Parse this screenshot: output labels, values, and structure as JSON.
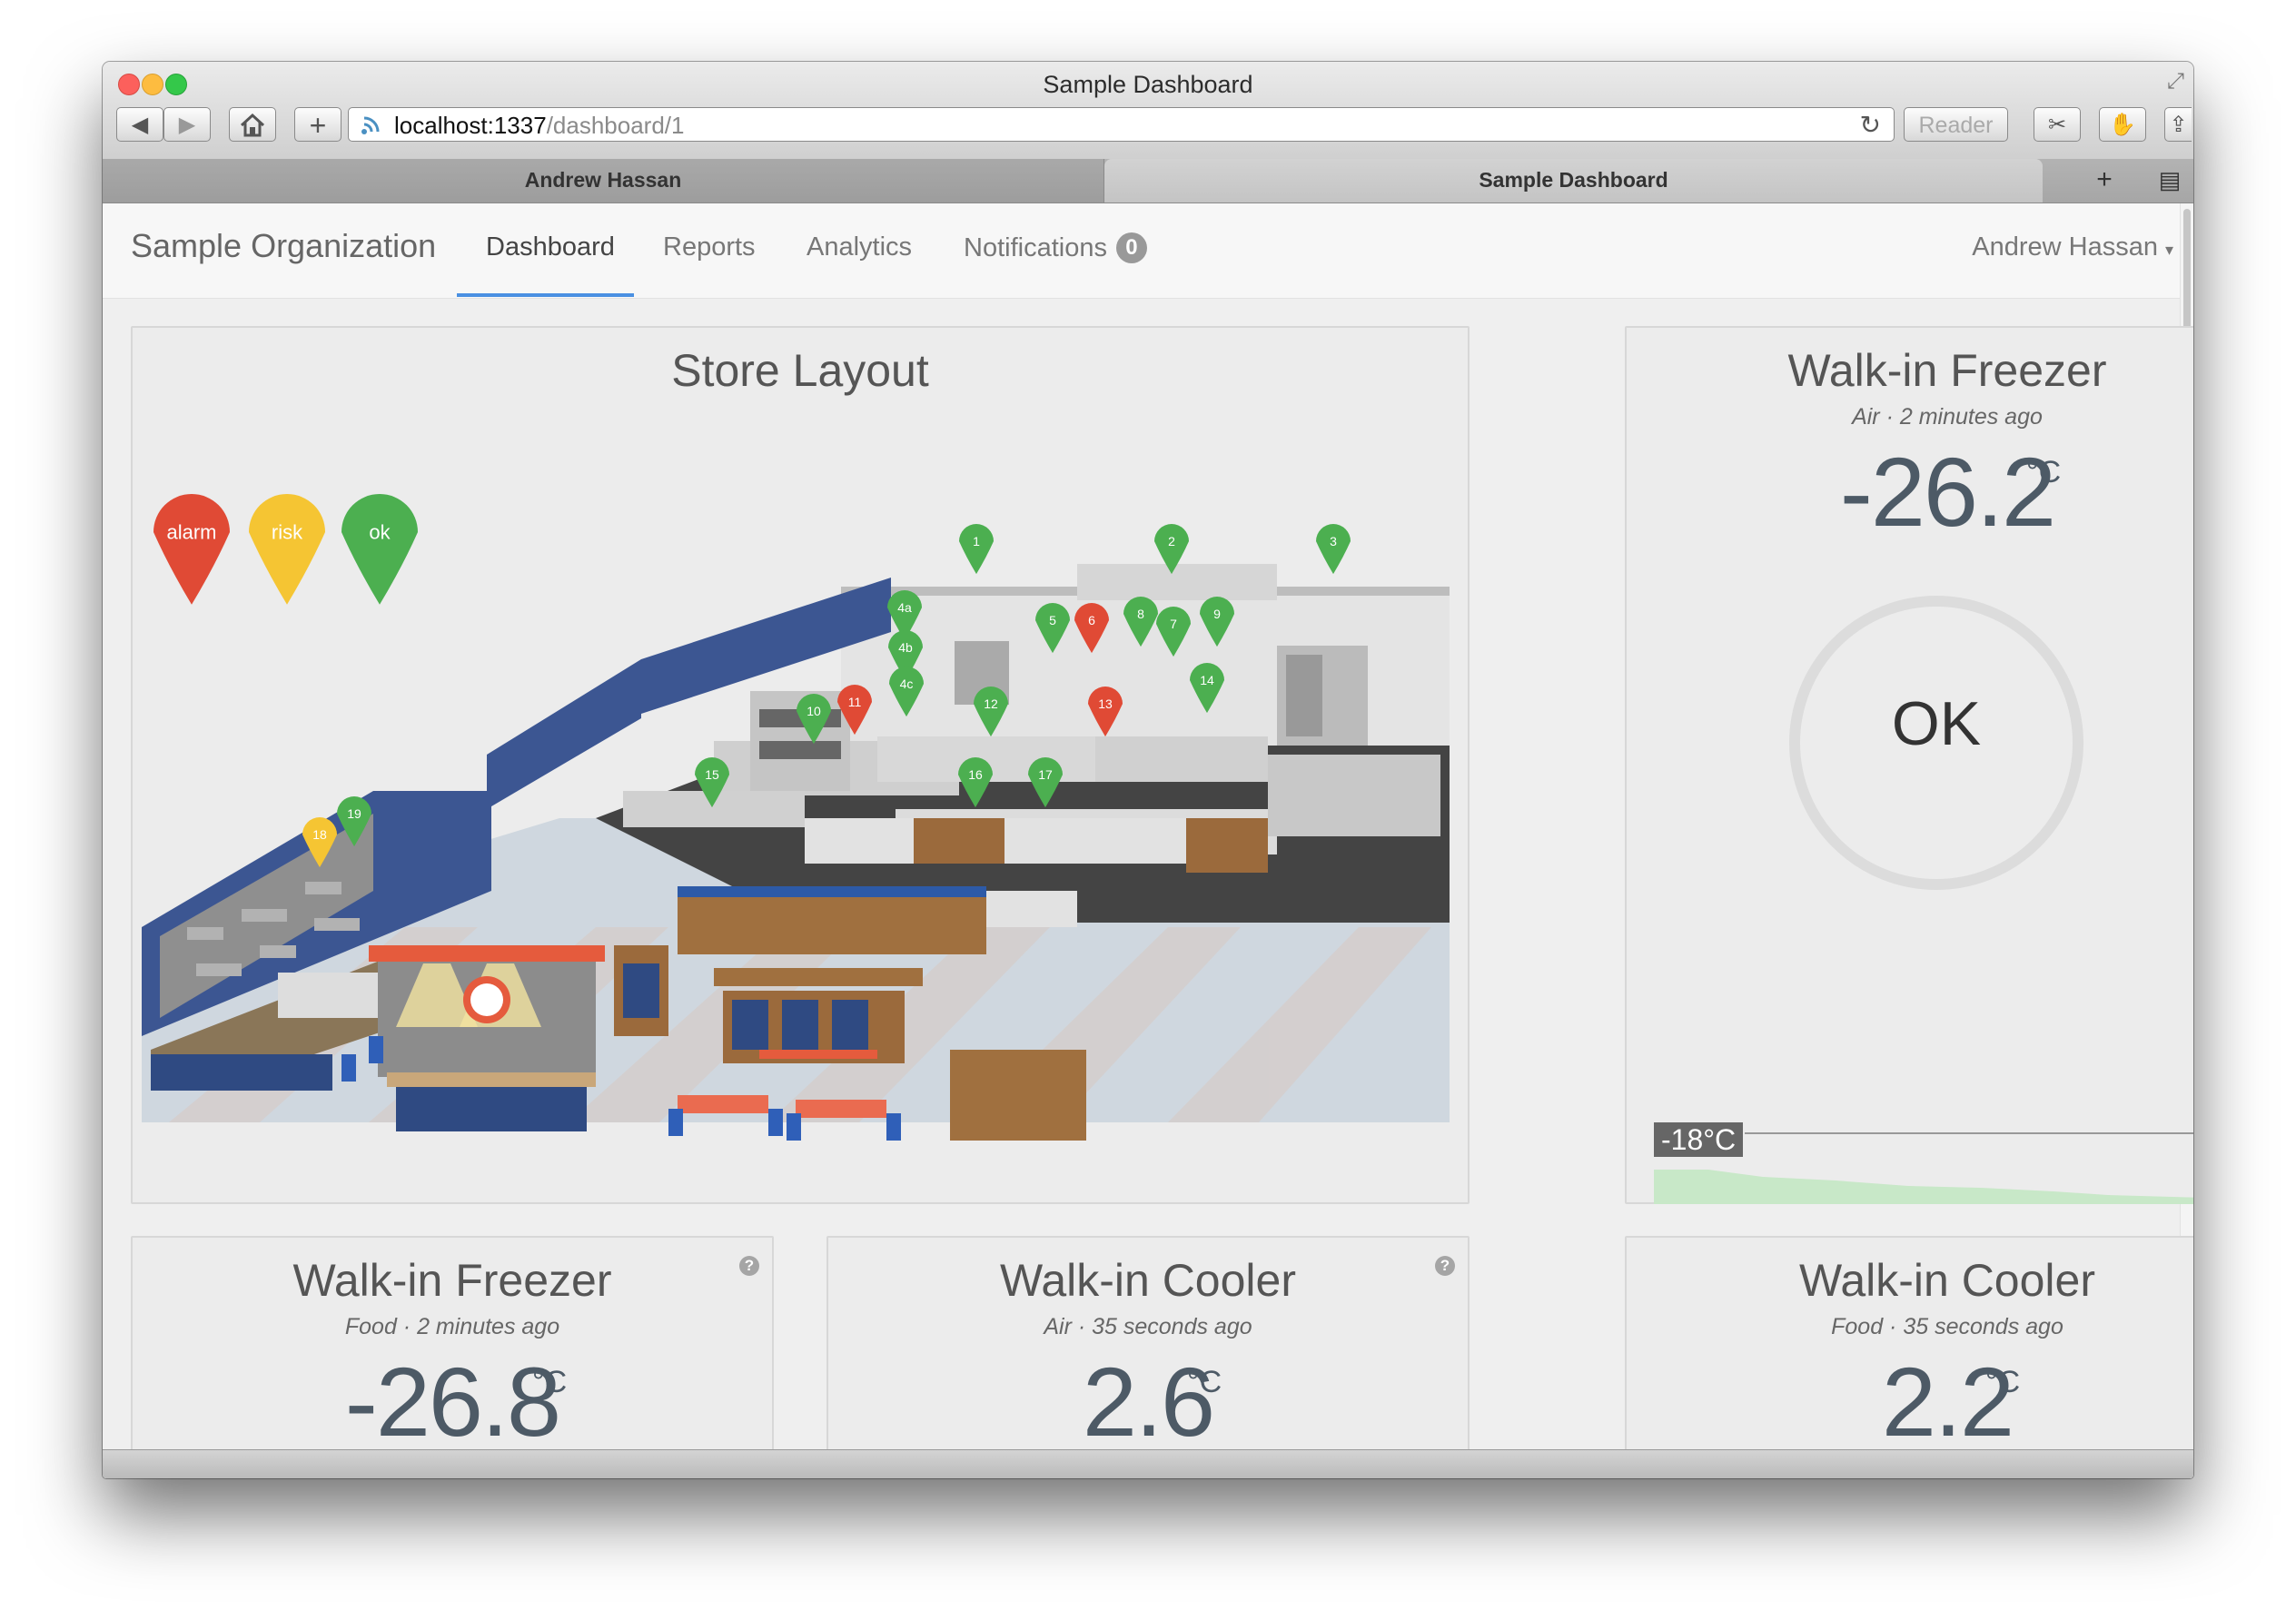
{
  "window": {
    "title": "Sample Dashboard",
    "colors": {
      "close": "#fc605c",
      "minimize": "#fdbc40",
      "zoom": "#34c84a"
    }
  },
  "toolbar": {
    "url_host": "localhost:1337",
    "url_path": "/dashboard/1",
    "reader_label": "Reader"
  },
  "tabs": [
    {
      "label": "Andrew Hassan",
      "active": false
    },
    {
      "label": "Sample Dashboard",
      "active": true
    }
  ],
  "navbar": {
    "brand": "Sample Organization",
    "items": [
      {
        "label": "Dashboard",
        "active": true
      },
      {
        "label": "Reports",
        "active": false
      },
      {
        "label": "Analytics",
        "active": false
      },
      {
        "label": "Notifications",
        "active": false,
        "badge": "0"
      }
    ],
    "user": "Andrew Hassan",
    "accent": "#4a90e2"
  },
  "store_layout": {
    "title": "Store Layout",
    "legend": [
      {
        "label": "alarm",
        "color": "#e04a35"
      },
      {
        "label": "risk",
        "color": "#f5c533"
      },
      {
        "label": "ok",
        "color": "#4caf50"
      }
    ],
    "markers": [
      {
        "label": "1",
        "status": "ok"
      },
      {
        "label": "2",
        "status": "ok"
      },
      {
        "label": "3",
        "status": "ok"
      },
      {
        "label": "4a",
        "status": "ok"
      },
      {
        "label": "4b",
        "status": "ok"
      },
      {
        "label": "4c",
        "status": "ok"
      },
      {
        "label": "5",
        "status": "ok"
      },
      {
        "label": "6",
        "status": "alarm"
      },
      {
        "label": "7",
        "status": "ok"
      },
      {
        "label": "8",
        "status": "ok"
      },
      {
        "label": "9",
        "status": "ok"
      },
      {
        "label": "10",
        "status": "ok"
      },
      {
        "label": "11",
        "status": "alarm"
      },
      {
        "label": "12",
        "status": "ok"
      },
      {
        "label": "13",
        "status": "alarm"
      },
      {
        "label": "14",
        "status": "ok"
      },
      {
        "label": "15",
        "status": "ok"
      },
      {
        "label": "16",
        "status": "ok"
      },
      {
        "label": "17",
        "status": "ok"
      },
      {
        "label": "18",
        "status": "risk"
      },
      {
        "label": "19",
        "status": "ok"
      }
    ]
  },
  "freezer_main": {
    "title": "Walk-in Freezer",
    "subtitle": "Air · 2 minutes ago",
    "value": "-26.2",
    "unit": "°C",
    "status": "OK",
    "threshold": "-18°C"
  },
  "cards": [
    {
      "title": "Walk-in Freezer",
      "subtitle": "Food · 2 minutes ago",
      "value": "-26.8",
      "unit": "°C"
    },
    {
      "title": "Walk-in Cooler",
      "subtitle": "Air · 35 seconds ago",
      "value": "2.6",
      "unit": "°C"
    },
    {
      "title": "Walk-in Cooler",
      "subtitle": "Food · 35 seconds ago",
      "value": "2.2",
      "unit": "°C"
    }
  ]
}
